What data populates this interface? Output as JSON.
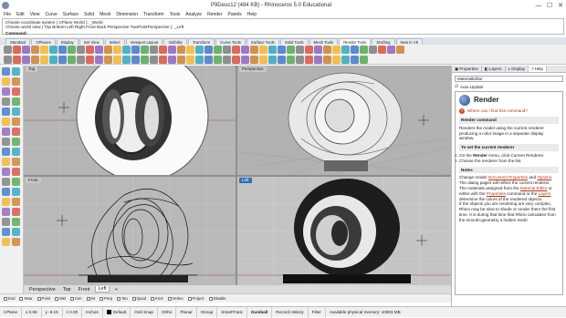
{
  "window": {
    "title": "P9Deus12 (484 KB) - Rhinoceros 5.0 Educational",
    "min_glyph": "—",
    "max_glyph": "☐",
    "close_glyph": "✕"
  },
  "menu": [
    "File",
    "Edit",
    "View",
    "Curve",
    "Surface",
    "Solid",
    "Mesh",
    "Dimension",
    "Transform",
    "Tools",
    "Analyze",
    "Render",
    "Panels",
    "Help"
  ],
  "command": {
    "history_line1": "Choose coordinate system ( CPlane  World ): _World",
    "history_line2": "Choose world view ( Top  Bottom  Left  Right  Front  Back  Perspective  TwoPointPerspective ): _Left",
    "prompt": "Command:"
  },
  "toolbar_tabs": [
    "Standard",
    "CPlanes",
    "Display",
    "Set View",
    "Select",
    "Viewport Layout",
    "Visibility",
    "Transform",
    "Curve Tools",
    "Surface Tools",
    "Solid Tools",
    "Mesh Tools",
    "Render Tools",
    "Drafting",
    "New in V5"
  ],
  "active_toolbar_tab": "Render Tools",
  "viewports": {
    "top": {
      "label": "Top"
    },
    "perspective": {
      "label": "Perspective"
    },
    "front": {
      "label": "Front"
    },
    "left": {
      "label": "Left"
    }
  },
  "viewport_tabs": [
    "Perspective",
    "Top",
    "Front",
    "Left"
  ],
  "active_viewport_tab": "Left",
  "add_tab_glyph": "+",
  "osnap": [
    "End",
    "Near",
    "Point",
    "Mid",
    "Cen",
    "Int",
    "Perp",
    "Tan",
    "Quad",
    "Knot",
    "Vertex",
    "Project",
    "Disable"
  ],
  "status": {
    "cplane": "CPlane",
    "x": "x 0.59",
    "y": "y -8.15",
    "z": "z 0.00",
    "units": "Inches",
    "layer": "Default",
    "grid_snap": "Grid Snap",
    "ortho": "Ortho",
    "planar": "Planar",
    "osnap": "Osnap",
    "smarttrack": "SmartTrack",
    "gumball": "Gumball",
    "record_history": "Record History",
    "filter": "Filter",
    "memory": "Available physical memory: 10003 MB"
  },
  "panel": {
    "tabs": [
      "Properties",
      "Layers",
      "Display",
      "Help"
    ],
    "active_tab": "Help",
    "field_value": "MaterialEditor",
    "auto_update": "Auto-Update",
    "help": {
      "title": "Render",
      "where": "Where can I find this command?",
      "command_heading": "Render command",
      "description": "Renders the model using the current renderer producing a color image in a separate display window.",
      "set_heading": "To set the current renderer",
      "step1_pre": "On the ",
      "step1_bold": "Render",
      "step1_post": " menu, click Current Renderer.",
      "step2": "Choose the renderer from the list.",
      "notes_heading": "Notes",
      "note1_pre": "Change render ",
      "note1_link1": "Document Properties",
      "note1_mid": " and ",
      "note1_link2": "Options",
      "note1_post": ". The dialog pages will reflect the current renderer.",
      "note2_pre": "The materials assigned from the ",
      "note2_link1": "Material Editor",
      "note2_mid": " or either with the ",
      "note2_link2": "Properties",
      "note2_mid2": " command or the ",
      "note2_link3": "Layers",
      "note2_post": " determine the colors of the rendered objects.",
      "note3": "If the objects you are rendering are very complex, Rhino may be slow to shade or render them the first time. It is during that time that Rhino calculates from the smooth-geometry a hidden mesh"
    }
  },
  "icons": {
    "left_toolbox": [
      "arrow-icon",
      "point-icon",
      "polyline-icon",
      "curve-icon",
      "circle-icon",
      "arc-icon",
      "ellipse-icon",
      "rectangle-icon",
      "polygon-icon",
      "text-icon",
      "fillet-icon",
      "offset-icon",
      "surface-icon",
      "extrude-icon",
      "loft-icon",
      "revolve-icon",
      "box-icon",
      "sphere-icon",
      "cylinder-icon",
      "boolean-icon",
      "mesh-icon",
      "move-icon",
      "copy-icon",
      "rotate-icon",
      "scale-icon",
      "mirror-icon",
      "array-icon",
      "trim-icon",
      "split-icon",
      "join-icon",
      "explode-icon",
      "group-icon",
      "dimension-icon",
      "hatch-icon",
      "analyze-icon",
      "render-icon"
    ]
  },
  "colors": {
    "active_label": "#2e6fbf",
    "help_red": "#b0341e"
  }
}
